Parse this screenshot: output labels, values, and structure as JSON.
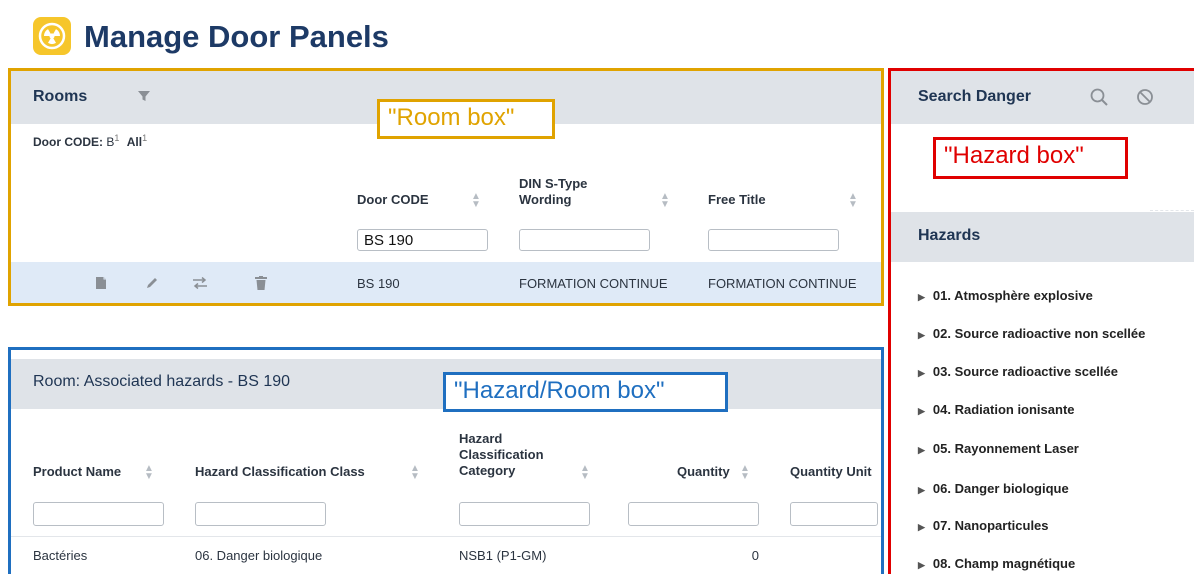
{
  "header": {
    "title": "Manage Door Panels",
    "icon": "radiation-icon"
  },
  "rooms": {
    "title": "Rooms",
    "filter_icon": "filter-icon",
    "breadcrumb_label": "Door CODE:",
    "breadcrumb_value": "B",
    "breadcrumb_value_count": "1",
    "breadcrumb_all": "All",
    "breadcrumb_all_count": "1",
    "columns": [
      {
        "label_lines": [
          "Door CODE"
        ],
        "filter_value": "BS 190"
      },
      {
        "label_lines": [
          "DIN S-Type",
          "Wording"
        ],
        "filter_value": ""
      },
      {
        "label_lines": [
          "Free Title"
        ],
        "filter_value": ""
      }
    ],
    "row": {
      "actions": [
        "copy-icon",
        "edit-icon",
        "swap-icon",
        "delete-icon"
      ],
      "cells": [
        "BS 190",
        "FORMATION CONTINUE",
        "FORMATION CONTINUE"
      ]
    }
  },
  "associated": {
    "title": "Room: Associated hazards - BS 190",
    "columns": [
      {
        "label_lines": [
          "Product Name"
        ]
      },
      {
        "label_lines": [
          "Hazard Classification Class"
        ]
      },
      {
        "label_lines": [
          "Hazard",
          "Classification",
          "Category"
        ]
      },
      {
        "label_lines": [
          "Quantity"
        ]
      },
      {
        "label_lines": [
          "Quantity Unit"
        ]
      }
    ],
    "rows": [
      [
        "Bactéries",
        "06. Danger biologique",
        "NSB1 (P1-GM)",
        "0",
        ""
      ]
    ]
  },
  "search": {
    "title": "Search Danger",
    "search_icon": "search-icon",
    "clear_icon": "clear-icon"
  },
  "hazards": {
    "title": "Hazards",
    "items": [
      "01. Atmosphère explosive",
      "02. Source radioactive non scellée",
      "03. Source radioactive scellée",
      "04. Radiation ionisante",
      "05. Rayonnement Laser",
      "06. Danger biologique",
      "07. Nanoparticules",
      "08. Champ magnétique"
    ]
  },
  "annotations": {
    "room_box": "\"Room box\"",
    "hazard_room_box": "\"Hazard/Room box\"",
    "hazard_box": "\"Hazard box\"",
    "colors": {
      "room": "#e0a300",
      "hazard_room": "#1f6fc0",
      "hazard": "#e00000"
    }
  }
}
